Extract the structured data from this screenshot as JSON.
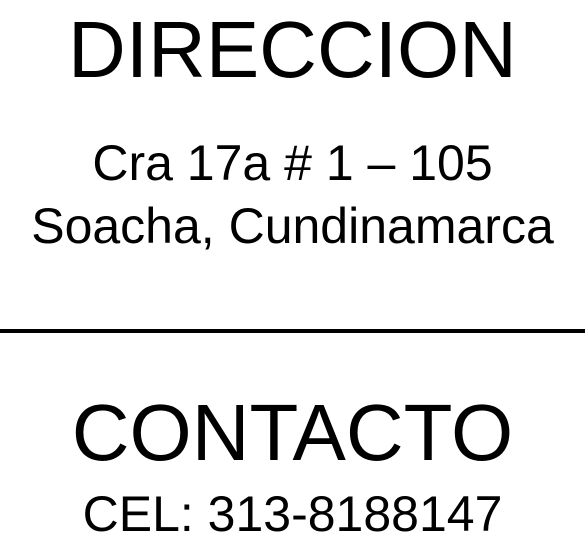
{
  "direccion": {
    "title": "DIRECCION",
    "address_line_1": "Cra 17a # 1 – 105",
    "address_line_2": "Soacha, Cundinamarca"
  },
  "contacto": {
    "title": "CONTACTO",
    "phone": "CEL: 313-8188147"
  },
  "colors": {
    "text": "#000000",
    "background": "#ffffff",
    "divider": "#000000"
  }
}
